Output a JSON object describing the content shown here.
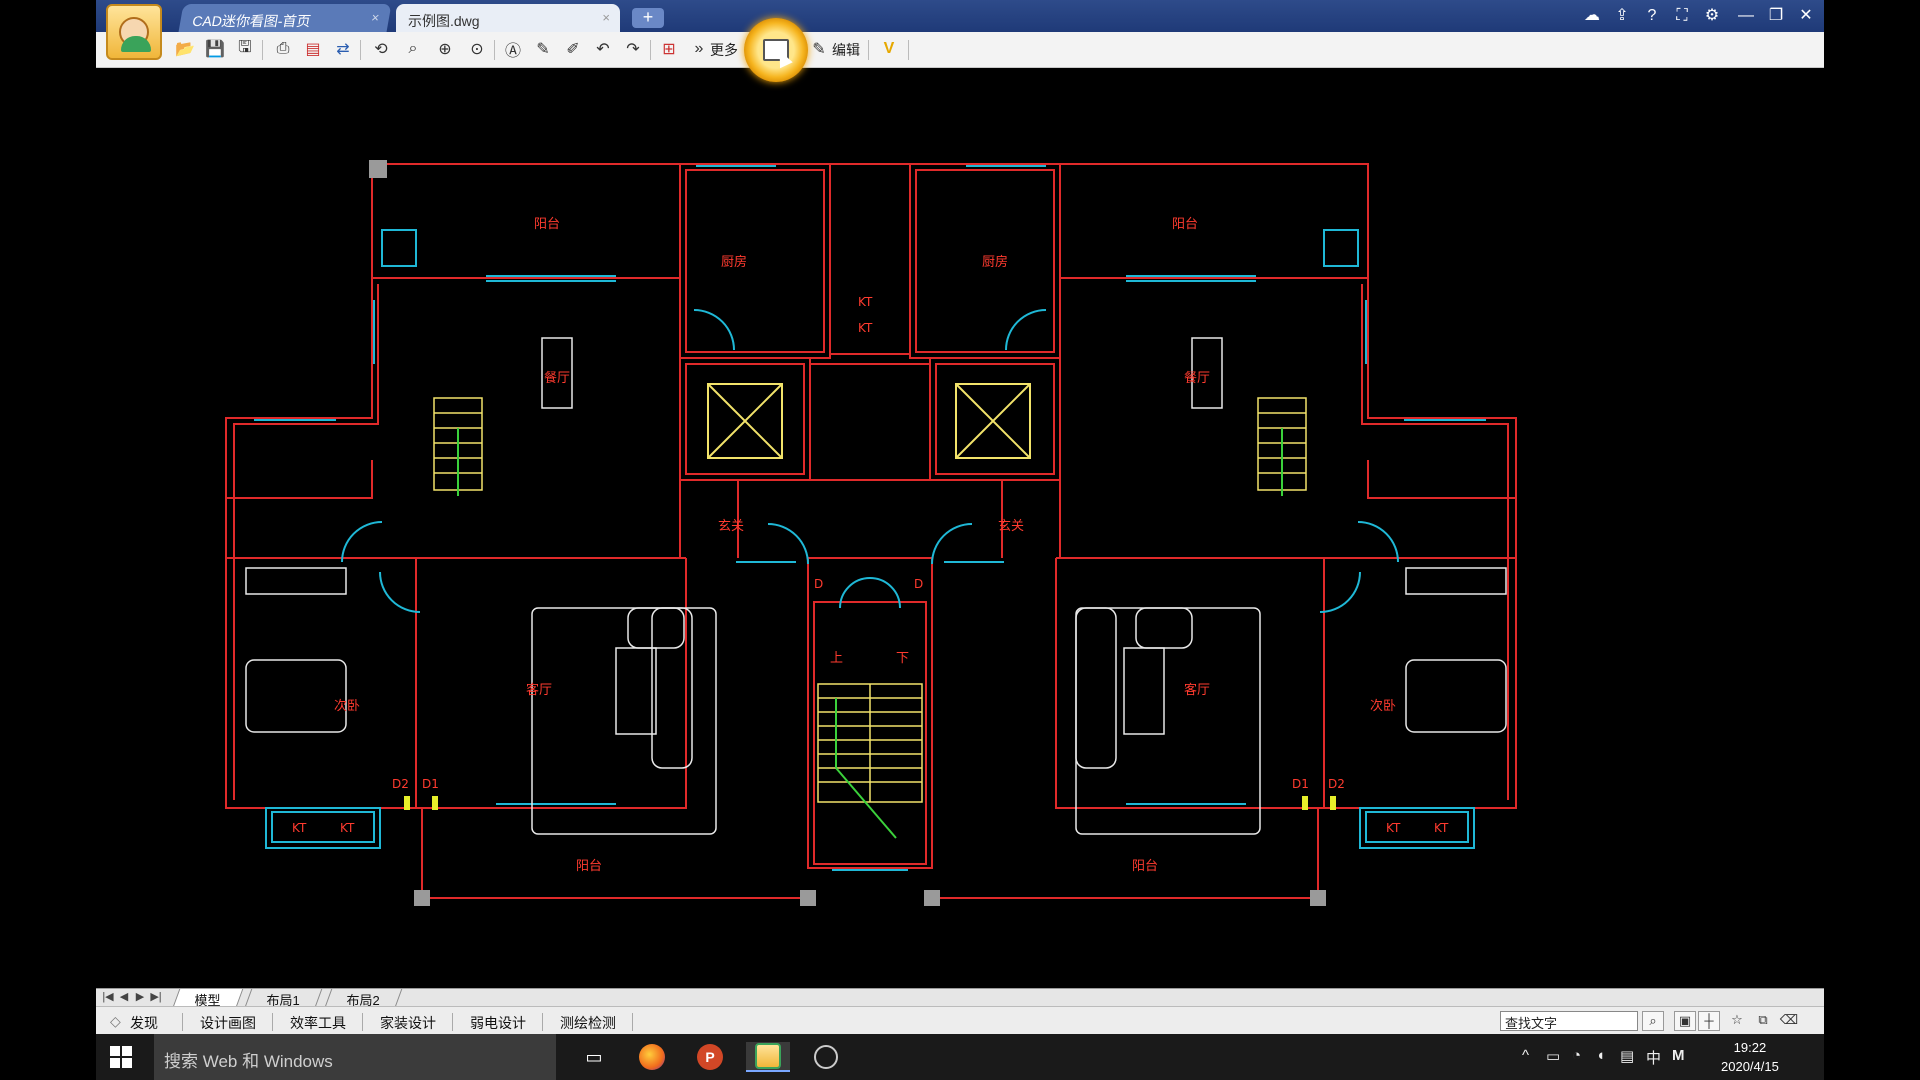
{
  "tabs": [
    {
      "label": "CAD迷你看图-首页",
      "close": "×"
    },
    {
      "label": "示例图.dwg",
      "close": "×"
    }
  ],
  "add_tab": "+",
  "window_controls": {
    "cloud": "☁",
    "share": "⇪",
    "help": "?",
    "fullscreen": "⛶",
    "settings": "⚙",
    "minimize": "—",
    "restore": "❐",
    "close": "✕"
  },
  "toolbar": {
    "more_label": "更多",
    "edit_label": "编辑",
    "icons": [
      "open-icon",
      "save-icon",
      "save-as-icon",
      "print-icon",
      "pdf-icon",
      "convert-icon",
      "rotate-icon",
      "zoom-window-icon",
      "zoom-in-icon",
      "zoom-extents-icon",
      "text-icon",
      "pencil-icon",
      "markup-icon",
      "undo-icon",
      "redo-icon",
      "measure-icon",
      "layer-icon",
      "more-icon",
      "compare-icon",
      "edit-icon",
      "vip-icon"
    ]
  },
  "drawing": {
    "rooms": {
      "balcony": "阳台",
      "kitchen": "厨房",
      "dining": "餐厅",
      "foyer": "玄关",
      "living": "客厅",
      "bedroom": "次卧",
      "ac": "KT",
      "stairs_up": "上",
      "stairs_down": "下",
      "door_d": "D",
      "door_d1": "D1",
      "door_d2": "D2"
    },
    "colors": {
      "wall": "#e02a2a",
      "fixture": "#1fb8d6",
      "furniture": "#ffffff",
      "stair": "#f2e36a",
      "text": "#ff3b2f",
      "green": "#3bd13b"
    }
  },
  "layout_tabs": [
    "模型",
    "布局1",
    "布局2"
  ],
  "layout_nav": [
    "|◀",
    "◀",
    "▶",
    "▶|"
  ],
  "bottom_tools": [
    "发现",
    "设计画图",
    "效率工具",
    "家装设计",
    "弱电设计",
    "测绘检测"
  ],
  "find_text": "查找文字",
  "taskbar": {
    "search_placeholder": "搜索 Web 和 Windows",
    "time": "19:22",
    "date": "2020/4/15",
    "ime": "中",
    "ime2": "M"
  }
}
